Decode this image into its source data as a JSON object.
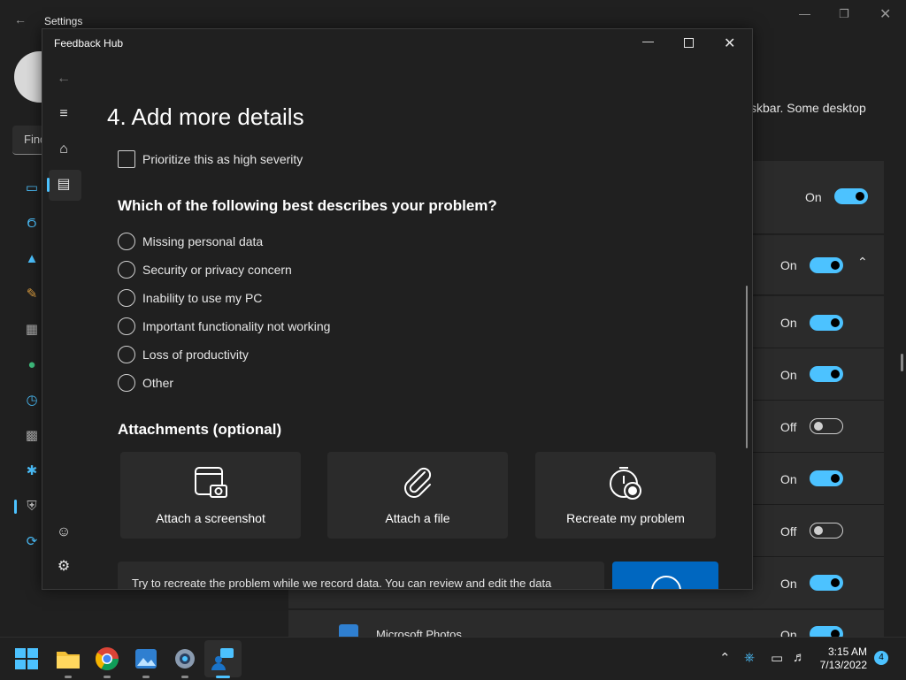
{
  "settings": {
    "title": "Settings",
    "search_placeholder": "Find",
    "description_fragment": "skbar. Some desktop",
    "rows": [
      {
        "state": "On",
        "toggle": "on"
      },
      {
        "state": "On",
        "toggle": "on"
      },
      {
        "state": "On",
        "toggle": "on"
      },
      {
        "state": "On",
        "toggle": "on"
      },
      {
        "state": "Off",
        "toggle": "off"
      },
      {
        "state": "On",
        "toggle": "on"
      },
      {
        "state": "Off",
        "toggle": "off"
      },
      {
        "state": "On",
        "toggle": "on"
      },
      {
        "state": "On",
        "toggle": "on"
      }
    ],
    "app_row_label": "Microsoft Photos"
  },
  "feedback": {
    "title": "Feedback Hub",
    "heading": "4. Add more details",
    "severity_label": "Prioritize this as high severity",
    "question": "Which of the following best describes your problem?",
    "options": [
      "Missing personal data",
      "Security or privacy concern",
      "Inability to use my PC",
      "Important functionality not working",
      "Loss of productivity",
      "Other"
    ],
    "attachments_title": "Attachments (optional)",
    "cards": [
      {
        "label": "Attach a screenshot"
      },
      {
        "label": "Attach a file"
      },
      {
        "label": "Recreate my problem"
      }
    ],
    "info_text": "Try to recreate the problem while we record data. You can review and edit the data"
  },
  "taskbar": {
    "time": "3:15 AM",
    "date": "7/13/2022",
    "notification_count": "4"
  },
  "colors": {
    "accent": "#4cc2ff",
    "button_blue": "#0067c0",
    "window_bg": "#202020",
    "card_bg": "#2b2b2b"
  }
}
